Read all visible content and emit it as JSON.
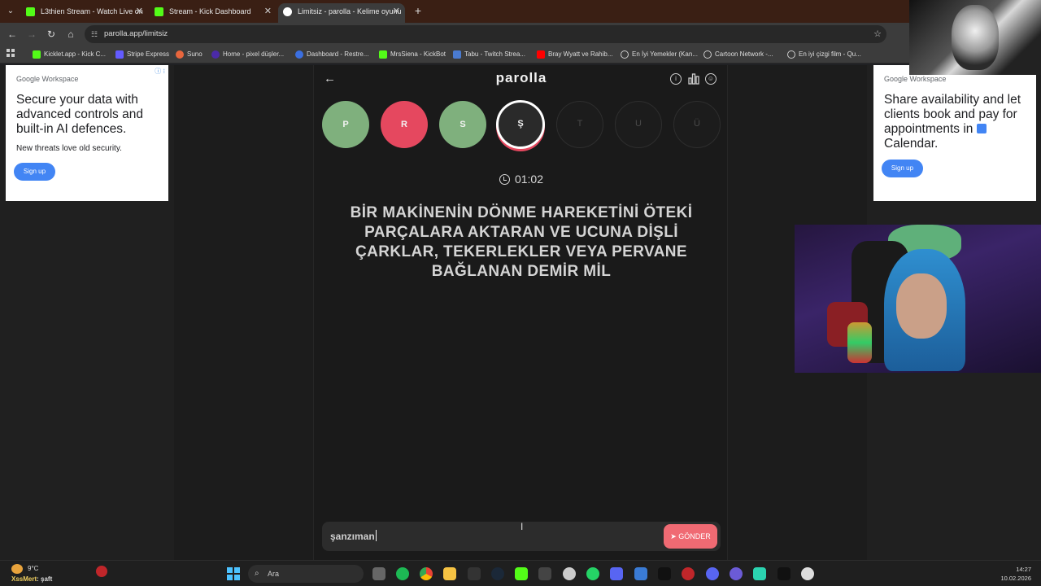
{
  "browser": {
    "tabs": [
      {
        "title": "L3thien Stream - Watch Live on",
        "active": false,
        "favicon_color": "#53fc18"
      },
      {
        "title": "Stream - Kick Dashboard",
        "active": false,
        "favicon_color": "#53fc18"
      },
      {
        "title": "Limitsiz - parolla - Kelime oyunu",
        "active": true,
        "favicon_color": "#ffffff"
      }
    ],
    "url": "parolla.app/limitsiz",
    "bookmarks": [
      "Kicklet.app - Kick C...",
      "Stripe Express",
      "Suno",
      "Home - pixel düşler...",
      "Dashboard - Restre...",
      "MrsSiena - KickBot",
      "Tabu - Twitch Strea...",
      "Bray Wyatt ve Rahib...",
      "En İyi Yemekler (Kan...",
      "Cartoon Network -...",
      "En iyi çizgi film - Qu..."
    ]
  },
  "ads": {
    "left": {
      "brand": "Google Workspace",
      "headline": "Secure your data with advanced controls and built-in AI defences.",
      "subtext": "New threats love old security.",
      "cta": "Sign up"
    },
    "right": {
      "brand": "Google Workspace",
      "headline_part1": "Share availability and let clients book and pay for appointments in",
      "headline_part2": "Calendar.",
      "cta": "Sign up"
    }
  },
  "game": {
    "logo": "parolla",
    "letters": [
      {
        "char": "P",
        "state": "correct"
      },
      {
        "char": "R",
        "state": "wrong"
      },
      {
        "char": "S",
        "state": "correct"
      },
      {
        "char": "Ş",
        "state": "current"
      },
      {
        "char": "T",
        "state": "pending"
      },
      {
        "char": "U",
        "state": "pending"
      },
      {
        "char": "Ü",
        "state": "pending"
      }
    ],
    "timer": "01:02",
    "question": "BİR MAKİNENİN DÖNME HAREKETİNİ ÖTEKİ PARÇALARA AKTARAN VE UCUNA DİŞLİ ÇARKLAR, TEKERLEKLER VEYA PERVANE BAĞLANAN DEMİR MİL",
    "answer_value": "şanzıman",
    "send_label": "GÖNDER"
  },
  "taskbar": {
    "temperature": "9°C",
    "weather_user": "XssMert",
    "weather_extra": ": şaft",
    "search_placeholder": "Ara",
    "time": "14:27",
    "date": "10.02.2026"
  },
  "colors": {
    "correct": "#7fb07d",
    "wrong": "#e5485f",
    "send": "#f06a73",
    "accent_blue": "#4285f4"
  }
}
